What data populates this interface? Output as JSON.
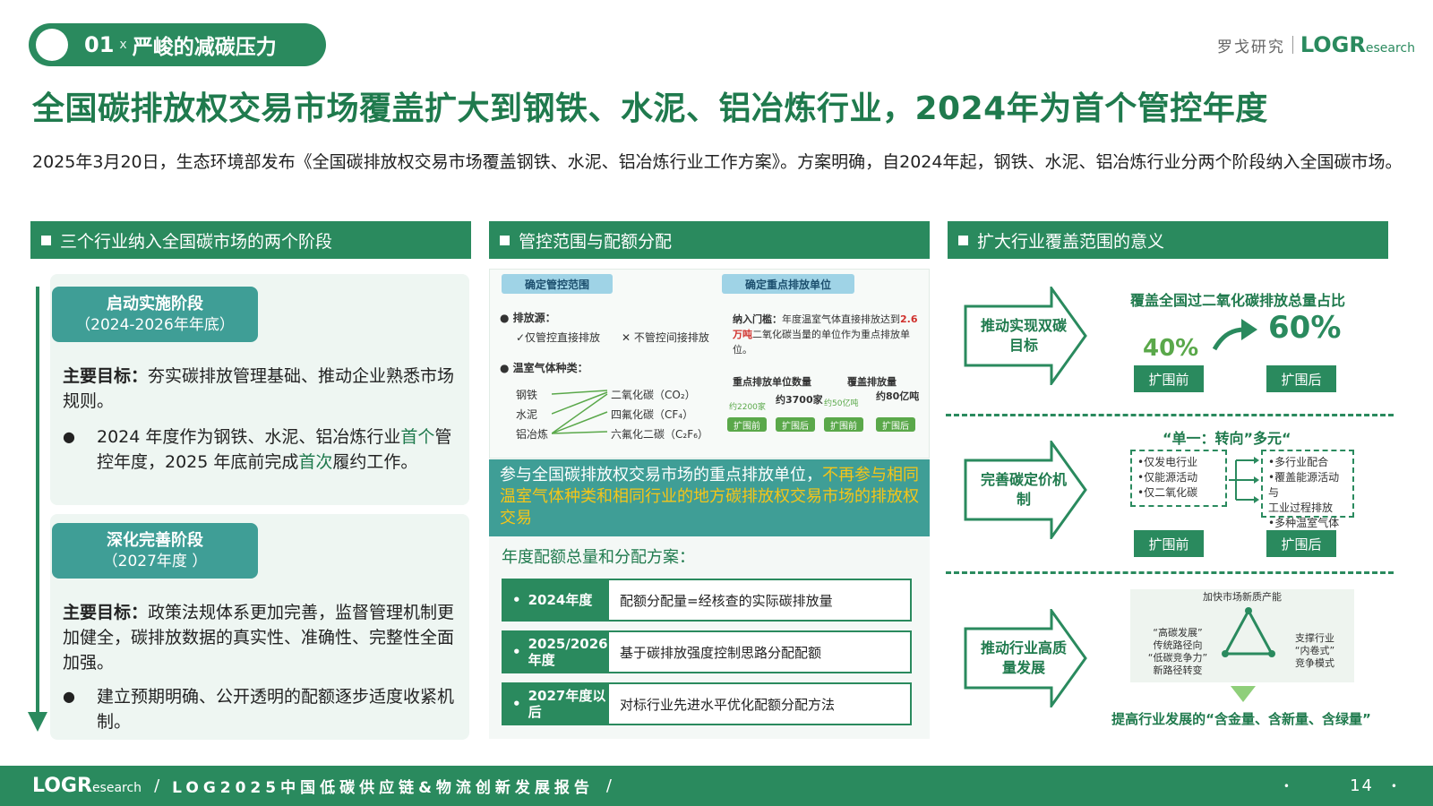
{
  "section": {
    "number": "01",
    "x": "x",
    "title": "严峻的减碳压力"
  },
  "brand": {
    "cn": "罗戈研究",
    "logo_main": "LOGR",
    "logo_tail": "esearch"
  },
  "title": "全国碳排放权交易市场覆盖扩大到钢铁、水泥、铝冶炼行业，2024年为首个管控年度",
  "intro": "2025年3月20日，生态环境部发布《全国碳排放权交易市场覆盖钢铁、水泥、铝冶炼行业工作方案》。方案明确，自2024年起，钢铁、水泥、铝冶炼行业分两个阶段纳入全国碳市场。",
  "panels": {
    "left": "三个行业纳入全国碳市场的两个阶段",
    "middle": "管控范围与配额分配",
    "right": "扩大行业覆盖范围的意义"
  },
  "stage1": {
    "name": "启动实施阶段",
    "period": "（2024-2026年年底）",
    "goal_label": "主要目标：",
    "goal": "夯实碳排放管理基础、推动企业熟悉市场规则。",
    "bullet_a": "2024 年度作为钢铁、水泥、铝冶炼行业",
    "bullet_hl1": "首个",
    "bullet_b": "管控年度，2025 年底前完成",
    "bullet_hl2": "首次",
    "bullet_c": "履约工作。"
  },
  "stage2": {
    "name": "深化完善阶段",
    "period": "（2027年度 ）",
    "goal_label": "主要目标：",
    "goal": "政策法规体系更加完善，监督管理机制更加健全，碳排放数据的真实性、准确性、完整性全面加强。",
    "bullet": "建立预期明确、公开透明的配额逐步适度收紧机制。"
  },
  "middle": {
    "tag_scope": "确定管控范围",
    "tag_units": "确定重点排放单位",
    "source_label": "● 排放源：",
    "direct": "✓仅管控直接排放",
    "indirect": "✕ 不管控间接排放",
    "gas_label": "● 温室气体种类：",
    "industries": [
      "钢铁",
      "水泥",
      "铝冶炼"
    ],
    "gases": [
      "二氧化碳（CO₂）",
      "四氟化碳（CF₄）",
      "六氟化二碳（C₂F₆）"
    ],
    "threshold_label": "纳入门槛：",
    "threshold_pre": "年度温室气体直接排放达到",
    "threshold_value": "2.6万吨",
    "threshold_post": "二氧化碳当量的单位作为重点排放单位。",
    "count_label": "重点排放单位数量",
    "volume_label": "覆盖排放量",
    "before_units": "约2200家",
    "after_units": "约3700家",
    "before_volume": "约50亿吨",
    "after_volume": "约80亿吨",
    "before": "扩围前",
    "after": "扩围后",
    "teal_a": "参与全国碳排放权交易市场的重点排放单位，",
    "teal_hl": "不再参与相同温室气体种类和相同行业的地方碳排放权交易市场的排放权交易",
    "quota_title": "年度配额总量和分配方案：",
    "quota": [
      {
        "year": "2024年度",
        "desc": "配额分配量=经核查的实际碳排放量"
      },
      {
        "year": "2025/2026年度",
        "desc": "基于碳排放强度控制思路分配配额"
      },
      {
        "year": "2027年度以后",
        "desc": "对标行业先进水平优化配额分配方法"
      }
    ]
  },
  "right": {
    "arrow1": "推动实现双碳目标",
    "arrow2": "完善碳定价机制",
    "arrow3": "推动行业高质量发展",
    "r1_title": "覆盖全国过二氧化碳排放总量占比",
    "pct_before": "40%",
    "pct_after": "60%",
    "before": "扩围前",
    "after": "扩围后",
    "r2_title": "“单一：转向”多元“",
    "r2_before": [
      "•仅发电行业",
      "•仅能源活动",
      "•仅二氧化碳"
    ],
    "r2_after": [
      "•多行业配合",
      "•覆盖能源活动与",
      "工业过程排放",
      "•多种温室气体"
    ],
    "r3_top": "加快市场新质产能",
    "r3_left": [
      "“高碳发展”",
      "传统路径向",
      "“低碳竞争力”",
      "新路径转变"
    ],
    "r3_right": [
      "支撑行业",
      "“内卷式”",
      "竞争模式"
    ],
    "r3_bottom": "提高行业发展的“含金量、含新量、含绿量”"
  },
  "footer": {
    "logo_main": "LOGR",
    "logo_tail": "esearch",
    "text": "LOG2025中国低碳供应链&物流创新发展报告",
    "page": "14"
  }
}
